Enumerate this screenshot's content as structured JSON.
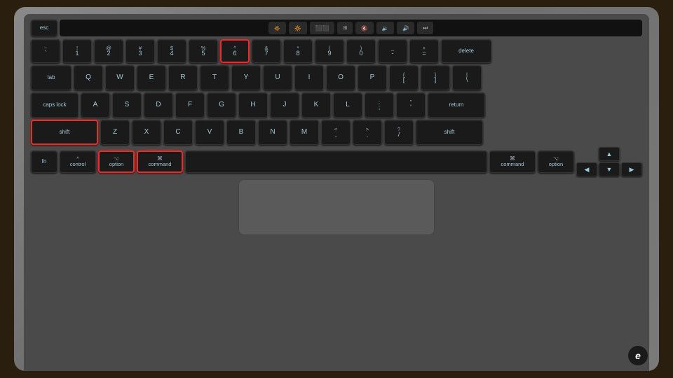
{
  "keyboard": {
    "function_row": {
      "esc": "esc",
      "brightness_down": "🔅",
      "brightness_up": "🔆",
      "mission_control": "⬛",
      "launchpad": "⊞",
      "mute": "🔇",
      "volume_down": "🔉",
      "volume_up": "🔊",
      "play_pause": "⏭"
    },
    "row1": [
      {
        "top": "~",
        "bottom": "`"
      },
      {
        "top": "!",
        "bottom": "1"
      },
      {
        "top": "@",
        "bottom": "2"
      },
      {
        "top": "#",
        "bottom": "3"
      },
      {
        "top": "$",
        "bottom": "4"
      },
      {
        "top": "%",
        "bottom": "5"
      },
      {
        "top": "^",
        "bottom": "6",
        "highlight": true
      },
      {
        "top": "&",
        "bottom": "7"
      },
      {
        "top": "*",
        "bottom": "8"
      },
      {
        "top": "(",
        "bottom": "9"
      },
      {
        "top": ")",
        "bottom": "0"
      },
      {
        "top": "_",
        "bottom": "-"
      },
      {
        "top": "+",
        "bottom": "="
      },
      {
        "label": "delete"
      }
    ],
    "row2": [
      "tab",
      "Q",
      "W",
      "E",
      "R",
      "T",
      "Y",
      "U",
      "I",
      "O",
      "P",
      "{[",
      "]}",
      "\\|"
    ],
    "row3": [
      "caps lock",
      "A",
      "S",
      "D",
      "F",
      "G",
      "H",
      "J",
      "K",
      "L",
      ":;",
      "'\"",
      "return"
    ],
    "row4": [
      "shift",
      "Z",
      "X",
      "C",
      "V",
      "B",
      "N",
      "M",
      "<,",
      ">.",
      "?/",
      "shift"
    ],
    "row5": [
      "fn",
      "control",
      "option",
      "command",
      "space",
      "command",
      "option"
    ],
    "highlighted_keys": [
      "shift_left",
      "option_left",
      "command_left",
      "key_6"
    ],
    "engadget_logo": "e"
  }
}
